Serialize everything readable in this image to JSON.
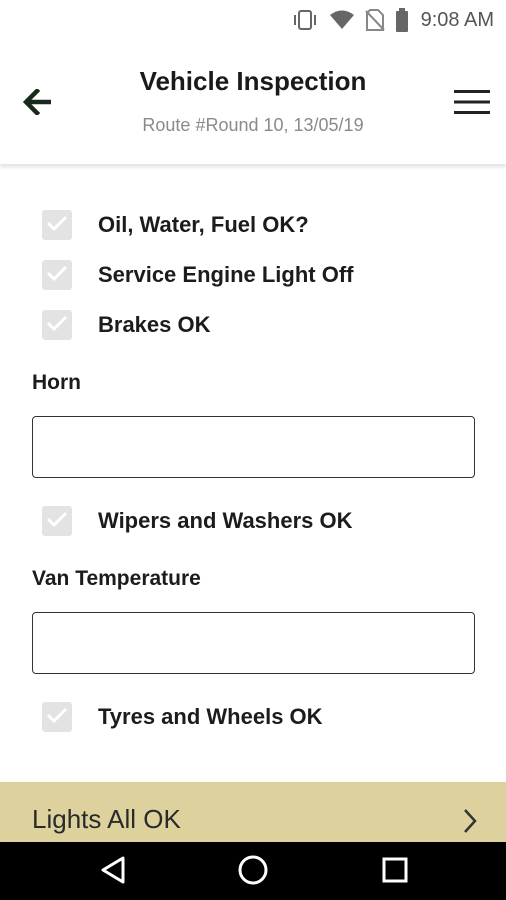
{
  "status_bar": {
    "time": "9:08 AM",
    "icons": [
      "vibrate-icon",
      "wifi-icon",
      "no-sim-icon",
      "battery-icon"
    ]
  },
  "header": {
    "title": "Vehicle Inspection",
    "subtitle": "Route #Round 10, 13/05/19",
    "back_icon": "arrow-left-icon",
    "menu_icon": "hamburger-menu-icon"
  },
  "checklist": {
    "items": [
      {
        "label": "Oil, Water, Fuel OK?",
        "checked": true
      },
      {
        "label": "Service Engine Light Off",
        "checked": true
      },
      {
        "label": "Brakes OK",
        "checked": true
      },
      {
        "label": "Wipers and Washers OK",
        "checked": true
      },
      {
        "label": "Tyres and Wheels OK",
        "checked": true
      }
    ]
  },
  "fields": {
    "horn": {
      "label": "Horn",
      "value": ""
    },
    "van_temperature": {
      "label": "Van Temperature",
      "value": ""
    }
  },
  "lights_bar": {
    "label": "Lights All OK",
    "icon": "chevron-right-icon"
  },
  "nav_bar": {
    "buttons": [
      "back-triangle-icon",
      "home-circle-icon",
      "recents-square-icon"
    ]
  },
  "colors": {
    "accent_bar": "#ddd29e",
    "checkbox_bg": "#e3e3e3",
    "checkmark": "#ffffff",
    "nav_bar": "#000000"
  }
}
